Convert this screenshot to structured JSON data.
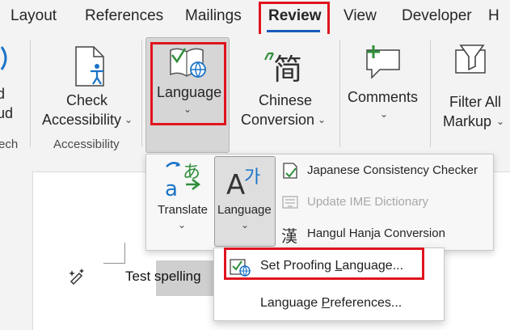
{
  "tabs": [
    {
      "label": "Layout"
    },
    {
      "label": "References"
    },
    {
      "label": "Mailings"
    },
    {
      "label": "Review"
    },
    {
      "label": "View"
    },
    {
      "label": "Developer"
    },
    {
      "label": "H"
    }
  ],
  "ribbon": {
    "read_aloud_partial": [
      "d",
      "ud"
    ],
    "speech_group_partial": "ech",
    "check_accessibility": [
      "Check",
      "Accessibility"
    ],
    "accessibility_group": "Accessibility",
    "language_label": "Language",
    "chinese_conversion": [
      "Chinese",
      "Conversion"
    ],
    "comments_label": "Comments",
    "filter_markup": [
      "Filter All",
      "Markup"
    ]
  },
  "language_menu": {
    "translate_label": "Translate",
    "language_label": "Language",
    "items": [
      {
        "label": "Japanese Consistency Checker",
        "enabled": true
      },
      {
        "label": "Update IME Dictionary",
        "enabled": false
      },
      {
        "label": "Hangul Hanja Conversion",
        "enabled": true
      }
    ]
  },
  "dropdown": {
    "set_proofing": {
      "pre": "Set Proofing ",
      "u": "L",
      "post": "anguage..."
    },
    "language_prefs": {
      "pre": "Language ",
      "u": "P",
      "post": "references..."
    }
  },
  "document": {
    "text": "Test spelling"
  },
  "colors": {
    "accent": "#185abd",
    "highlight_box": "#e0141e"
  }
}
